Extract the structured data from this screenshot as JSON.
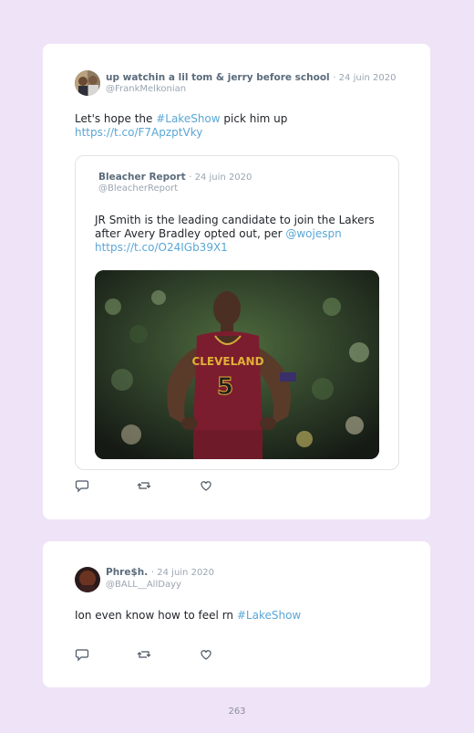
{
  "tweets": [
    {
      "author": "up watchin a lil tom & jerry before school",
      "date": "· 24 juin 2020",
      "handle": "@FrankMelkonian",
      "text_before": "Let's hope the ",
      "hashtag": "#LakeShow",
      "text_after": " pick him up",
      "url": "https://t.co/F7ApzptVky",
      "quoted": {
        "author": "Bleacher Report",
        "date": "· 24 juin 2020",
        "handle": "@BleacherReport",
        "text_line1": "JR Smith is the leading candidate to join the Lakers",
        "text_line2": "after Avery Bradley opted out, per ",
        "mention": "@wojespn",
        "url": "https://t.co/O24IGb39X1",
        "image": {
          "jersey_text": "CLEVELAND",
          "jersey_number": "5"
        }
      }
    },
    {
      "author": "Phre$h.",
      "date": "· 24 juin 2020",
      "handle": "@BALL__AllDayy",
      "text_before": "Ion even know how to feel rn ",
      "hashtag": "#LakeShow"
    }
  ],
  "actions": {
    "reply_icon": "reply-icon",
    "retweet_icon": "retweet-icon",
    "like_icon": "heart-icon"
  },
  "colors": {
    "background": "#efe3f7",
    "card": "#ffffff",
    "link": "#5aa7d6",
    "jersey": "#7b1d2e"
  },
  "page_number": "263"
}
